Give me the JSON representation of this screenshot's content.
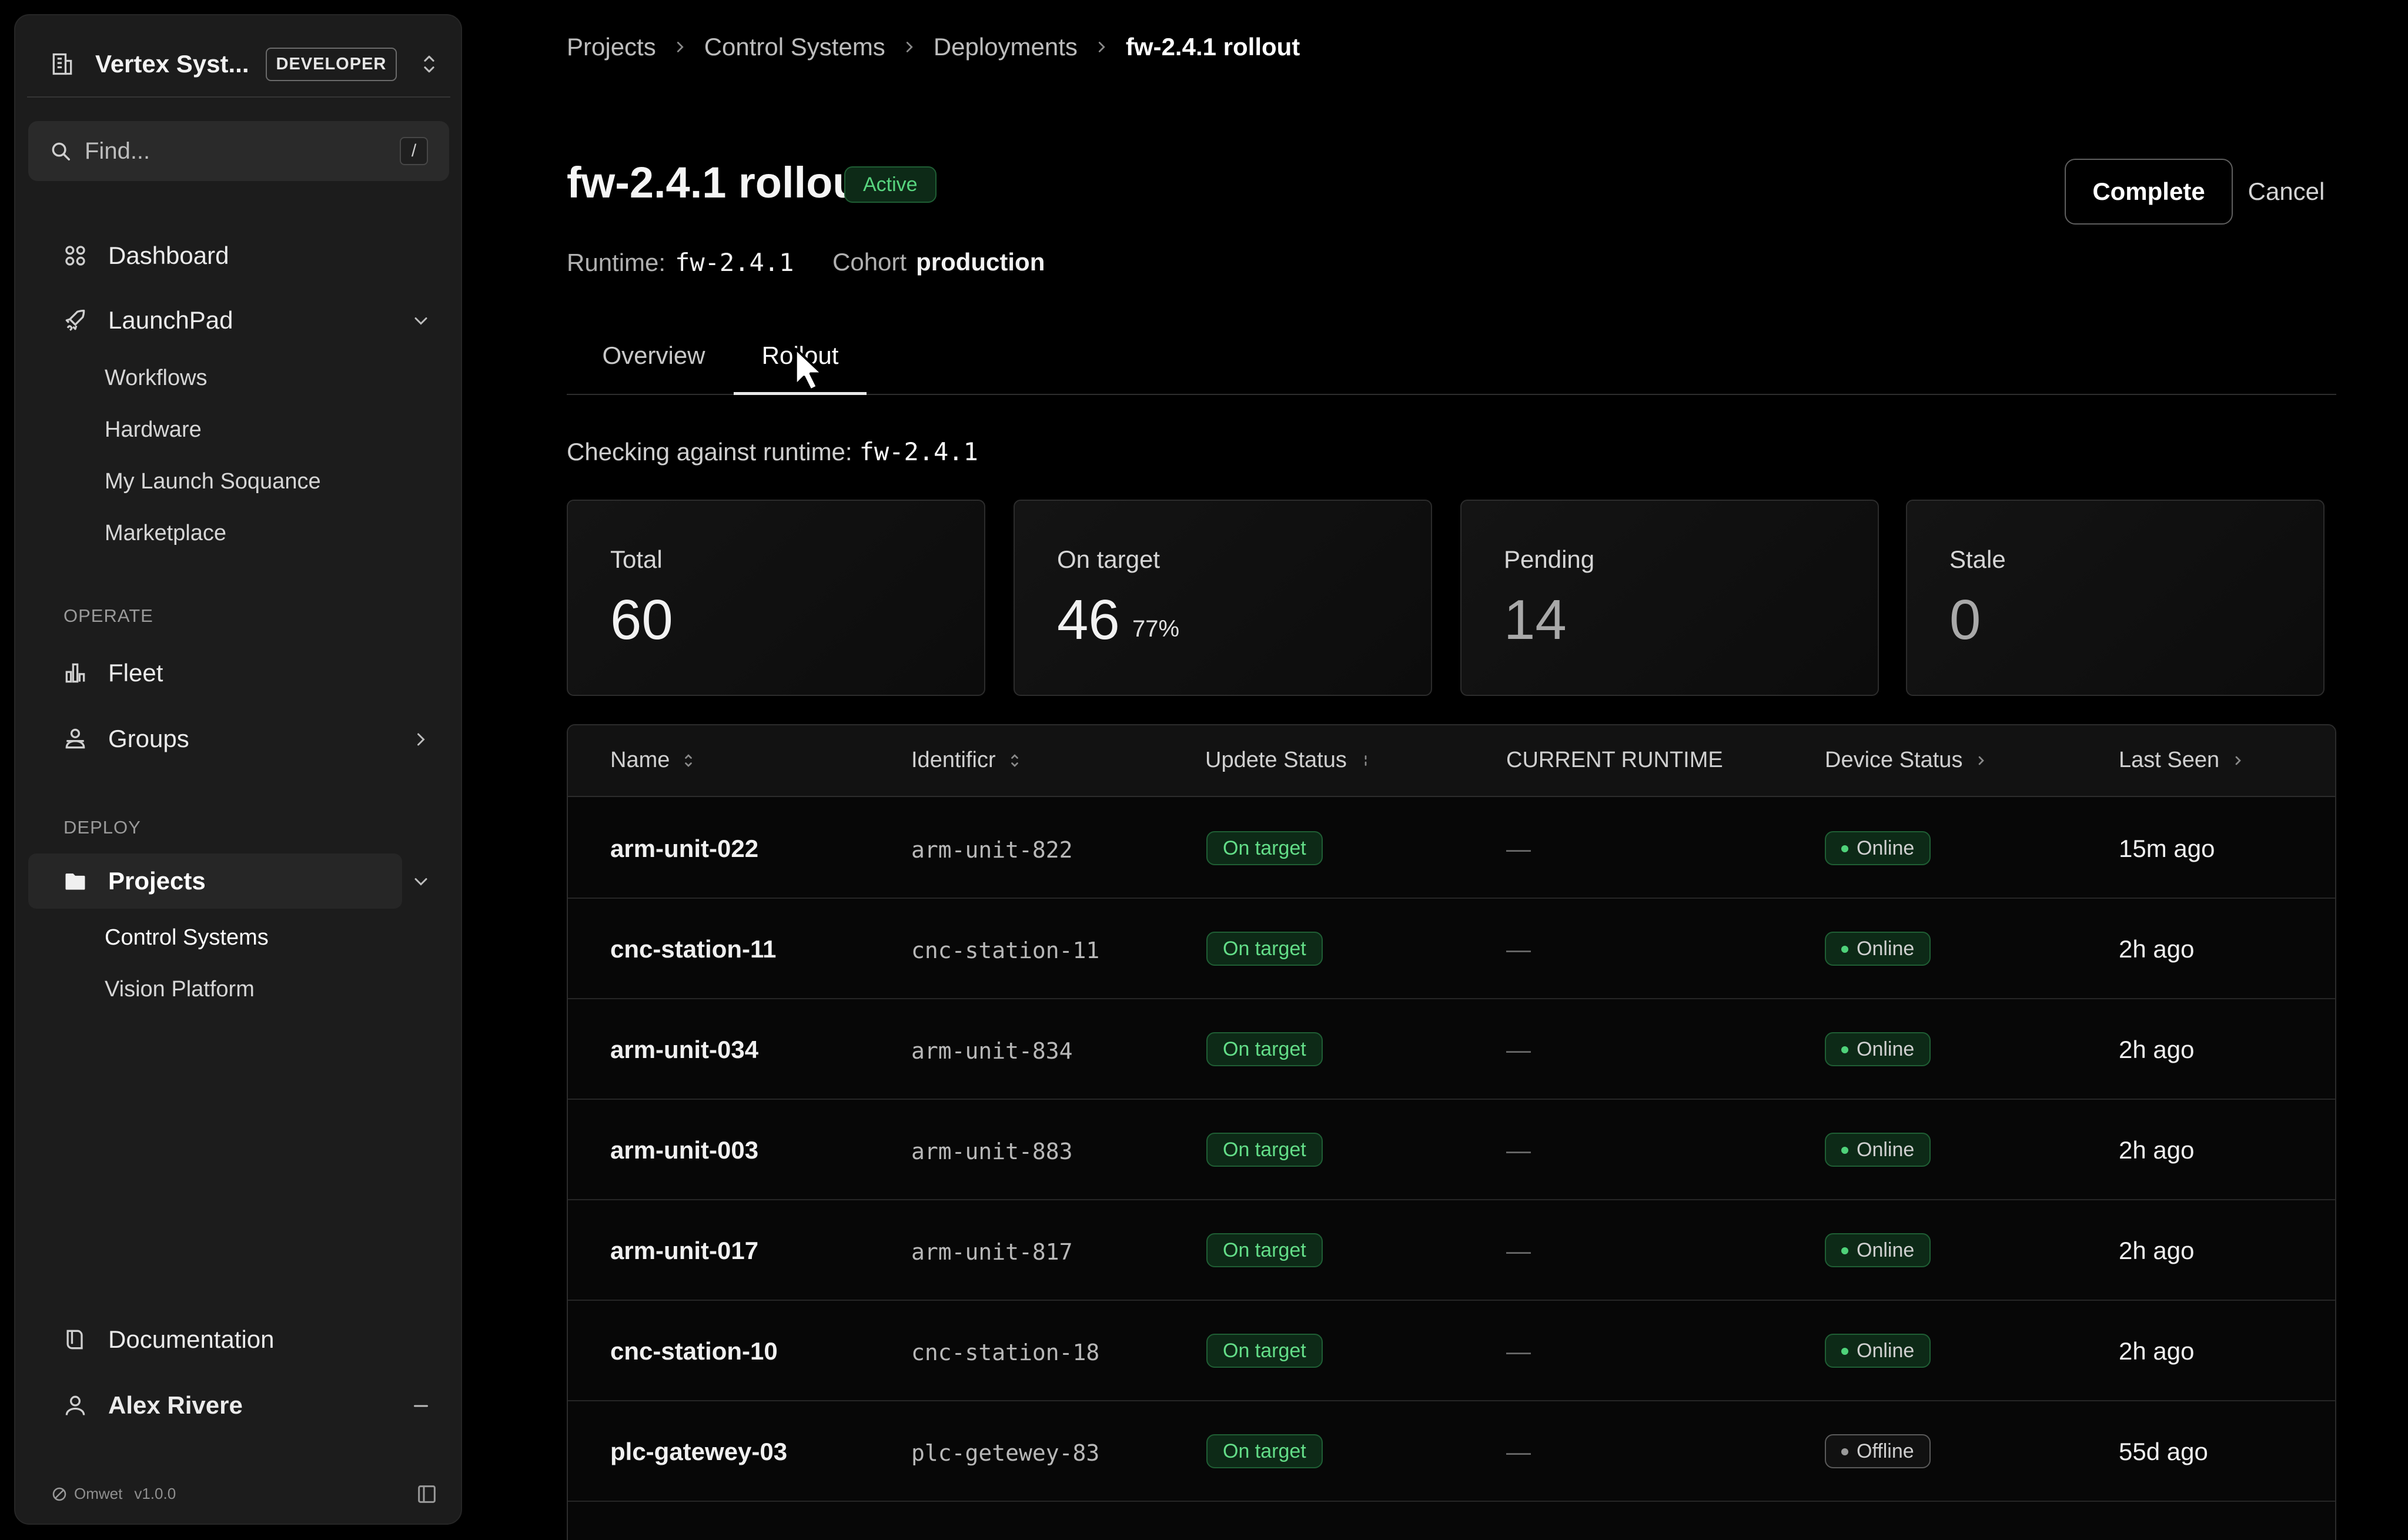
{
  "sidebar": {
    "org_name": "Vertex Syst...",
    "env_badge": "DEVELOPER",
    "search_placeholder": "Find...",
    "search_shortcut": "/",
    "nav": {
      "dashboard": "Dashboard",
      "launchpad": "LaunchPad",
      "launchpad_items": [
        "Workflows",
        "Hardware",
        "My Launch Soquance",
        "Marketplace"
      ],
      "operate_label": "OPERATE",
      "fleet": "Fleet",
      "groups": "Groups",
      "deploy_label": "DEPLOY",
      "projects": "Projects",
      "project_items": [
        "Control Systems",
        "Vision Platform"
      ],
      "documentation": "Documentation",
      "user": "Alex Rivere"
    },
    "footer": {
      "brand": "Omwet",
      "version": "v1.0.0"
    }
  },
  "breadcrumb": [
    "Projects",
    "Control Systems",
    "Deployments",
    "fw-2.4.1 rollout"
  ],
  "header": {
    "title": "fw-2.4.1 rollout",
    "status": "Active",
    "complete_label": "Complete",
    "cancel_label": "Cancel",
    "runtime_label": "Runtime:",
    "runtime_value": "fw-2.4.1",
    "cohort_label": "Cohort",
    "cohort_value": "production"
  },
  "tabs": [
    "Overview",
    "Rollout"
  ],
  "active_tab": "Rollout",
  "checking": {
    "label": "Checking against runtime:",
    "value": "fw-2.4.1"
  },
  "stats": [
    {
      "label": "Total",
      "value": "60"
    },
    {
      "label": "On target",
      "value": "46",
      "pct": "77%"
    },
    {
      "label": "Pending",
      "value": "14"
    },
    {
      "label": "Stale",
      "value": "0"
    }
  ],
  "table": {
    "columns": [
      "Name",
      "Identificr",
      "Updete Status",
      "CURRENT RUNTIME",
      "Device Status",
      "Last Seen"
    ],
    "rows": [
      {
        "name": "arm-unit-022",
        "identifier": "arm-unit-822",
        "update_status": "On target",
        "current_runtime": "—",
        "device_status": "Online",
        "last_seen": "15m ago"
      },
      {
        "name": "cnc-station-11",
        "identifier": "cnc-station-11",
        "update_status": "On target",
        "current_runtime": "—",
        "device_status": "Online",
        "last_seen": "2h ago"
      },
      {
        "name": "arm-unit-034",
        "identifier": "arm-unit-834",
        "update_status": "On target",
        "current_runtime": "—",
        "device_status": "Online",
        "last_seen": "2h ago"
      },
      {
        "name": "arm-unit-003",
        "identifier": "arm-unit-883",
        "update_status": "On target",
        "current_runtime": "—",
        "device_status": "Online",
        "last_seen": "2h ago"
      },
      {
        "name": "arm-unit-017",
        "identifier": "arm-unit-817",
        "update_status": "On target",
        "current_runtime": "—",
        "device_status": "Online",
        "last_seen": "2h ago"
      },
      {
        "name": "cnc-station-10",
        "identifier": "cnc-station-18",
        "update_status": "On target",
        "current_runtime": "—",
        "device_status": "Online",
        "last_seen": "2h ago"
      },
      {
        "name": "plc-gatewey-03",
        "identifier": "plc-getewey-83",
        "update_status": "On target",
        "current_runtime": "—",
        "device_status": "Offline",
        "last_seen": "55d ago"
      }
    ]
  },
  "colors": {
    "accent_green": "#58d57f",
    "badge_bg": "#0d2a17",
    "background": "#000000",
    "sidebar_bg": "#1c1c1c"
  },
  "icons": [
    "building-icon",
    "updown-icon",
    "search-icon",
    "dashboard-icon",
    "rocket-icon",
    "chevron-down-icon",
    "chart-icon",
    "groups-icon",
    "chevron-right-icon",
    "folder-icon",
    "book-icon",
    "user-icon",
    "collapse-icon",
    "brand-icon",
    "panel-icon",
    "sort-icon"
  ]
}
